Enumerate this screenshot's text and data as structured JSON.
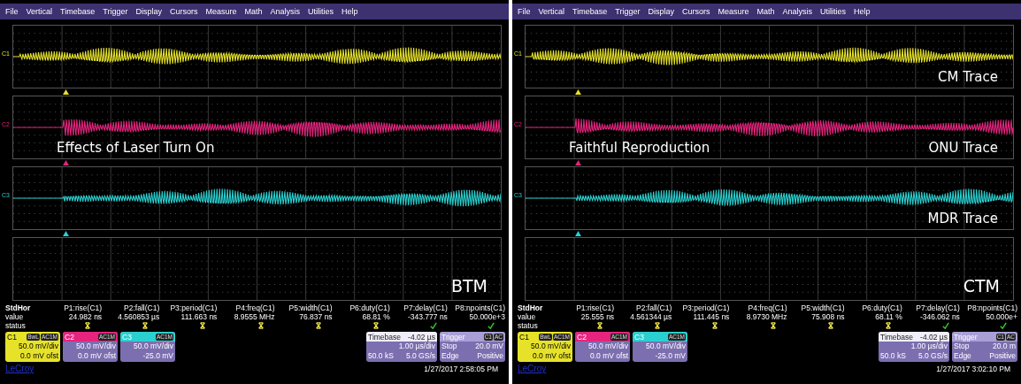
{
  "scopes": [
    {
      "menu": [
        "File",
        "Vertical",
        "Timebase",
        "Trigger",
        "Display",
        "Cursors",
        "Measure",
        "Math",
        "Analysis",
        "Utilities",
        "Help"
      ],
      "channels": [
        {
          "name": "C1",
          "color": "#e6e22a"
        },
        {
          "name": "C2",
          "color": "#e6247e",
          "left_annotation": "Effects of Laser Turn On"
        },
        {
          "name": "C3",
          "color": "#2ad0d0"
        }
      ],
      "empty_grid_label": "BTM",
      "measurements": {
        "header": "StdHor",
        "row_labels": [
          "value",
          "status"
        ],
        "columns": [
          {
            "name": "P1:rise(C1)",
            "value": "24.982 ns",
            "passed": false
          },
          {
            "name": "P2:fall(C1)",
            "value": "4.560853 µs",
            "passed": false
          },
          {
            "name": "P3:period(C1)",
            "value": "111.663 ns",
            "passed": false
          },
          {
            "name": "P4:freq(C1)",
            "value": "8.9555 MHz",
            "passed": false
          },
          {
            "name": "P5:width(C1)",
            "value": "76.837 ns",
            "passed": false
          },
          {
            "name": "P6:duty(C1)",
            "value": "68.81 %",
            "passed": false
          },
          {
            "name": "P7:delay(C1)",
            "value": "-343.777 ns",
            "passed": true
          },
          {
            "name": "P8:npoints(C1)",
            "value": "50.000e+3",
            "passed": true
          }
        ]
      },
      "channel_boxes": [
        {
          "name": "C1",
          "selected": true,
          "tags": [
            "BwL",
            "AC1M"
          ],
          "lines": [
            "50.0 mV/div",
            "0.0 mV ofst"
          ]
        },
        {
          "name": "C2",
          "selected": false,
          "tags": [
            "AC1M"
          ],
          "lines": [
            "50.0 mV/div",
            "0.0 mV ofst"
          ]
        },
        {
          "name": "C3",
          "selected": false,
          "tags": [
            "AC1M"
          ],
          "lines": [
            "50.0 mV/div",
            "-25.0 mV"
          ]
        }
      ],
      "timebase": {
        "title": "Timebase",
        "value": "-4.02 µs",
        "rows": [
          {
            "right": "1.00 µs/div"
          },
          {
            "left": "50.0 kS",
            "right": "5.0 GS/s"
          }
        ]
      },
      "trigger": {
        "title": "Trigger",
        "tags": [
          "C1",
          "AC"
        ],
        "rows": [
          {
            "left": "Stop",
            "right": "20.0 mV"
          },
          {
            "left": "Edge",
            "right": "Positive"
          }
        ]
      },
      "timestamp": "1/27/2017 2:58:05 PM",
      "logo": "LeCroy"
    },
    {
      "menu": [
        "File",
        "Vertical",
        "Timebase",
        "Trigger",
        "Display",
        "Cursors",
        "Measure",
        "Math",
        "Analysis",
        "Utilities",
        "Help"
      ],
      "channels": [
        {
          "name": "C1",
          "color": "#e6e22a",
          "right_annotation": "CM Trace"
        },
        {
          "name": "C2",
          "color": "#e6247e",
          "left_annotation": "Faithful Reproduction",
          "right_annotation": "ONU Trace"
        },
        {
          "name": "C3",
          "color": "#2ad0d0",
          "right_annotation": "MDR Trace"
        }
      ],
      "empty_grid_label": "CTM",
      "measurements": {
        "header": "StdHor",
        "row_labels": [
          "value",
          "status"
        ],
        "columns": [
          {
            "name": "P1:rise(C1)",
            "value": "25.555 ns",
            "passed": false
          },
          {
            "name": "P2:fall(C1)",
            "value": "4.561344 µs",
            "passed": false
          },
          {
            "name": "P3:period(C1)",
            "value": "111.445 ns",
            "passed": false
          },
          {
            "name": "P4:freq(C1)",
            "value": "8.9730 MHz",
            "passed": false
          },
          {
            "name": "P5:width(C1)",
            "value": "75.908 ns",
            "passed": false
          },
          {
            "name": "P6:duty(C1)",
            "value": "68.11 %",
            "passed": false
          },
          {
            "name": "P7:delay(C1)",
            "value": "-346.062 ns",
            "passed": true
          },
          {
            "name": "P8:npoints(C1)",
            "value": "50.000e+",
            "passed": true
          }
        ]
      },
      "channel_boxes": [
        {
          "name": "C1",
          "selected": true,
          "tags": [
            "BwL",
            "AC1M"
          ],
          "lines": [
            "50.0 mV/div",
            "0.0 mV ofst"
          ]
        },
        {
          "name": "C2",
          "selected": false,
          "tags": [
            "AC1M"
          ],
          "lines": [
            "50.0 mV/div",
            "0.0 mV ofst"
          ]
        },
        {
          "name": "C3",
          "selected": false,
          "tags": [
            "AC1M"
          ],
          "lines": [
            "50.0 mV/div",
            "-25.0 mV"
          ]
        }
      ],
      "timebase": {
        "title": "Timebase",
        "value": "-4.02 µs",
        "rows": [
          {
            "right": "1.00 µs/div"
          },
          {
            "left": "50.0 kS",
            "right": "5.0 GS/s"
          }
        ]
      },
      "trigger": {
        "title": "Trigger",
        "tags": [
          "C1",
          "AC"
        ],
        "rows": [
          {
            "left": "Stop",
            "right": "20.0 m"
          },
          {
            "left": "Edge",
            "right": "Positive"
          }
        ]
      },
      "timestamp": "1/27/2017 3:02:10 PM",
      "logo": "LeCroy"
    }
  ]
}
